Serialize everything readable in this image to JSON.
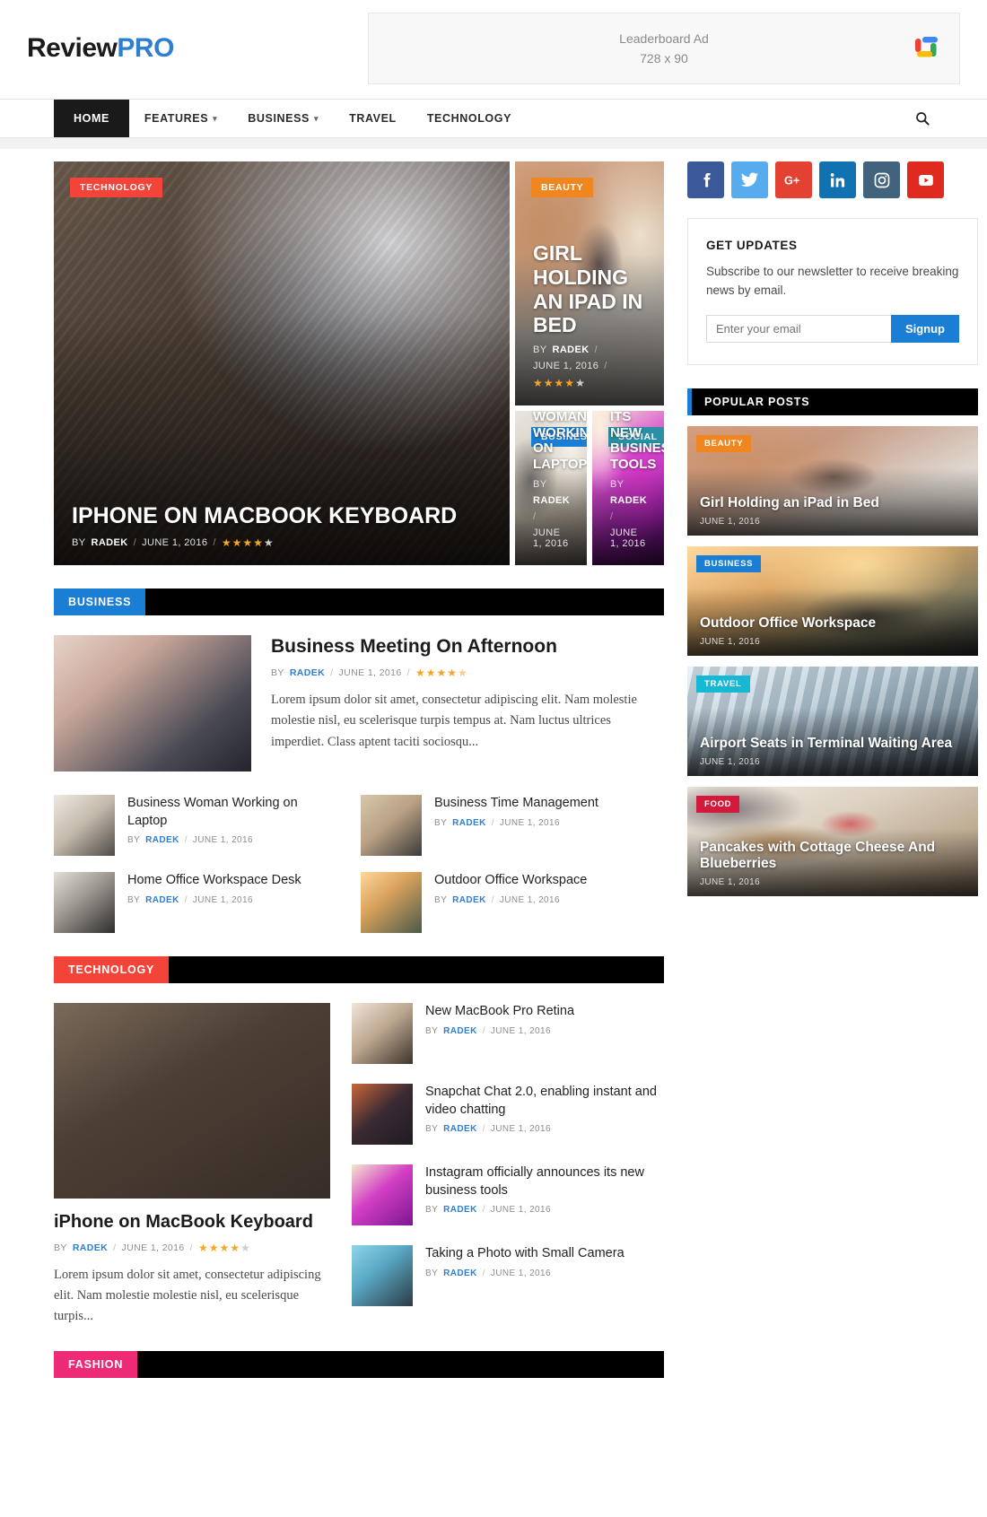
{
  "site": {
    "logo_review": "Review",
    "logo_pro": "PRO"
  },
  "ad": {
    "line1": "Leaderboard Ad",
    "line2": "728 x 90",
    "icon": "google-ads-icon"
  },
  "nav": {
    "items": [
      {
        "label": "HOME",
        "active": true,
        "caret": false
      },
      {
        "label": "FEATURES",
        "active": false,
        "caret": true
      },
      {
        "label": "BUSINESS",
        "active": false,
        "caret": true
      },
      {
        "label": "TRAVEL",
        "active": false,
        "caret": false
      },
      {
        "label": "TECHNOLOGY",
        "active": false,
        "caret": false
      }
    ],
    "search_icon": "search-icon"
  },
  "hero": {
    "main": {
      "category": "TECHNOLOGY",
      "title": "IPHONE ON MACBOOK KEYBOARD",
      "by_prefix": "BY",
      "author": "RADEK",
      "date": "JUNE 1, 2016",
      "rating": 4,
      "rating_max": 5
    },
    "top": {
      "category": "BEAUTY",
      "title": "GIRL HOLDING AN IPAD IN BED",
      "by_prefix": "BY",
      "author": "RADEK",
      "date": "JUNE 1, 2016",
      "rating": 4,
      "rating_max": 5
    },
    "small": [
      {
        "category": "BUSINESS",
        "title": "BUSINESS WOMAN WORKING ON LAPTOP",
        "by_prefix": "BY",
        "author": "RADEK",
        "date": "JUNE 1, 2016"
      },
      {
        "category": "SOCIAL",
        "title": "INSTAGRAM OFFICIALLY ANNOUNCES ITS NEW BUSINESS TOOLS",
        "by_prefix": "BY",
        "author": "RADEK",
        "date": "JUNE 1, 2016"
      }
    ]
  },
  "business_section": {
    "tag": "BUSINESS",
    "featured": {
      "title": "Business Meeting On Afternoon",
      "by_prefix": "BY",
      "author": "RADEK",
      "date": "JUNE 1, 2016",
      "rating": 4.5,
      "rating_max": 5,
      "excerpt": "Lorem ipsum dolor sit amet, consectetur adipiscing elit. Nam molestie molestie nisl, eu scelerisque turpis tempus at. Nam luctus ultrices imperdiet. Class aptent taciti sociosqu..."
    },
    "posts": [
      {
        "title": "Business Woman Working on Laptop",
        "by_prefix": "BY",
        "author": "RADEK",
        "date": "JUNE 1, 2016"
      },
      {
        "title": "Business Time Management",
        "by_prefix": "BY",
        "author": "RADEK",
        "date": "JUNE 1, 2016"
      },
      {
        "title": "Home Office Workspace Desk",
        "by_prefix": "BY",
        "author": "RADEK",
        "date": "JUNE 1, 2016"
      },
      {
        "title": "Outdoor Office Workspace",
        "by_prefix": "BY",
        "author": "RADEK",
        "date": "JUNE 1, 2016"
      }
    ]
  },
  "technology_section": {
    "tag": "TECHNOLOGY",
    "featured": {
      "title": "iPhone on MacBook Keyboard",
      "by_prefix": "BY",
      "author": "RADEK",
      "date": "JUNE 1, 2016",
      "rating": 4,
      "rating_max": 5,
      "excerpt": "Lorem ipsum dolor sit amet, consectetur adipiscing elit. Nam molestie molestie nisl, eu scelerisque turpis..."
    },
    "posts": [
      {
        "title": "New MacBook Pro Retina",
        "by_prefix": "BY",
        "author": "RADEK",
        "date": "JUNE 1, 2016"
      },
      {
        "title": "Snapchat Chat 2.0, enabling instant and video chatting",
        "by_prefix": "BY",
        "author": "RADEK",
        "date": "JUNE 1, 2016"
      },
      {
        "title": "Instagram officially announces its new business tools",
        "by_prefix": "BY",
        "author": "RADEK",
        "date": "JUNE 1, 2016"
      },
      {
        "title": "Taking a Photo with Small Camera",
        "by_prefix": "BY",
        "author": "RADEK",
        "date": "JUNE 1, 2016"
      }
    ]
  },
  "fashion_section": {
    "tag": "FASHION"
  },
  "sidebar": {
    "social": [
      {
        "name": "facebook-icon",
        "color": "#3b5998"
      },
      {
        "name": "twitter-icon",
        "color": "#56acee"
      },
      {
        "name": "google-plus-icon",
        "color": "#e34132"
      },
      {
        "name": "linkedin-icon",
        "color": "#1072b1"
      },
      {
        "name": "instagram-icon",
        "color": "#41637e"
      },
      {
        "name": "youtube-icon",
        "color": "#e02a20"
      }
    ],
    "newsletter": {
      "heading": "GET UPDATES",
      "text": "Subscribe to our newsletter to receive breaking news by email.",
      "placeholder": "Enter your email",
      "value": "",
      "button": "Signup"
    },
    "popular": {
      "heading": "POPULAR POSTS",
      "items": [
        {
          "category": "BEAUTY",
          "cat_class": "beauty",
          "title": "Girl Holding an iPad in Bed",
          "date": "JUNE 1, 2016"
        },
        {
          "category": "BUSINESS",
          "cat_class": "business",
          "title": "Outdoor Office Workspace",
          "date": "JUNE 1, 2016"
        },
        {
          "category": "TRAVEL",
          "cat_class": "travel",
          "title": "Airport Seats in Terminal Waiting Area",
          "date": "JUNE 1, 2016"
        },
        {
          "category": "FOOD",
          "cat_class": "food",
          "title": "Pancakes with Cottage Cheese And Blueberries",
          "date": "JUNE 1, 2016"
        }
      ]
    }
  },
  "colors": {
    "accent_blue": "#1a7fd4",
    "tech_red": "#f4443a",
    "beauty_orange": "#f0861f",
    "social_teal": "#2b8fa6",
    "travel_cyan": "#16b8d4",
    "food_red": "#d41a3c",
    "fashion_pink": "#ec2a76",
    "star_gold": "#f5a623",
    "logo_blue": "#2f7fd1"
  }
}
